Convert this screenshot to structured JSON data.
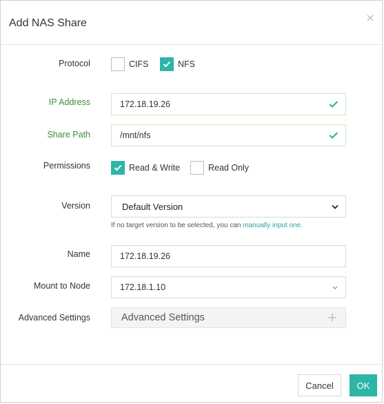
{
  "dialog": {
    "title": "Add NAS Share"
  },
  "protocol": {
    "label": "Protocol",
    "options": [
      {
        "label": "CIFS",
        "checked": false
      },
      {
        "label": "NFS",
        "checked": true
      }
    ]
  },
  "ip_address": {
    "label": "IP Address",
    "value": "172.18.19.26"
  },
  "share_path": {
    "label": "Share Path",
    "value": "/mnt/nfs"
  },
  "permissions": {
    "label": "Permissions",
    "options": [
      {
        "label": "Read & Write",
        "checked": true
      },
      {
        "label": "Read Only",
        "checked": false
      }
    ]
  },
  "version": {
    "label": "Version",
    "value": "Default Version",
    "hint": "If no target version to be selected, you can ",
    "hint_link": "manually input one."
  },
  "name": {
    "label": "Name",
    "value": "172.18.19.26"
  },
  "mount": {
    "label": "Mount to Node",
    "value": "172.18.1.10"
  },
  "advanced": {
    "label": "Advanced Settings",
    "button": "Advanced Settings"
  },
  "footer": {
    "cancel": "Cancel",
    "ok": "OK"
  },
  "colors": {
    "accent": "#2db5a8",
    "valid_label": "#3c8c3c"
  }
}
